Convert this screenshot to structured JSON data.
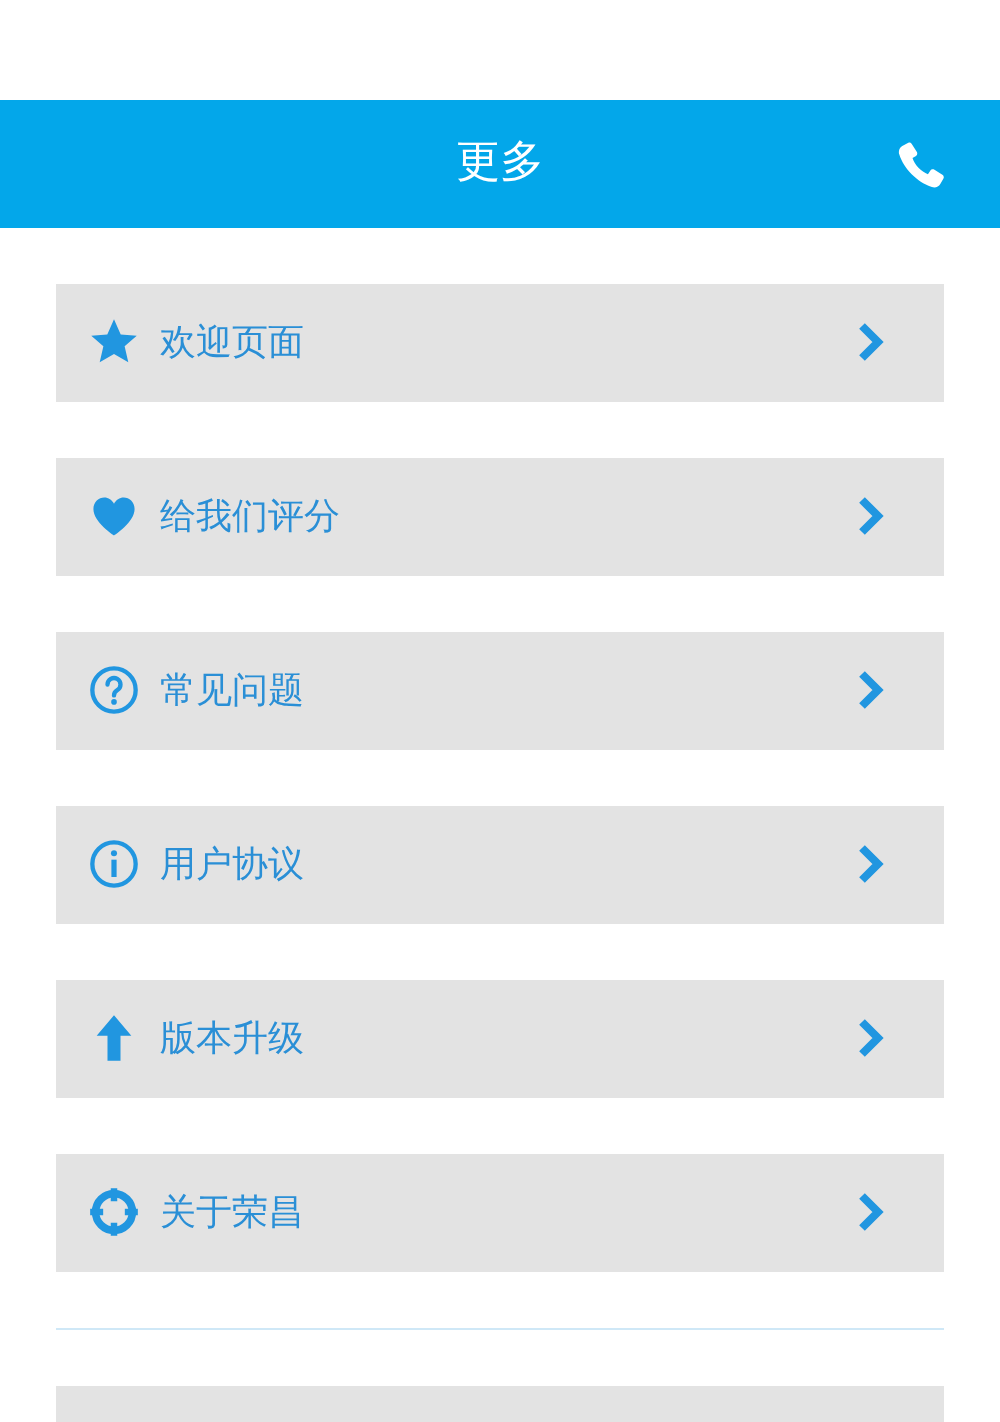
{
  "header": {
    "title": "更多"
  },
  "items": [
    {
      "label": "欢迎页面"
    },
    {
      "label": "给我们评分"
    },
    {
      "label": "常见问题"
    },
    {
      "label": "用户协议"
    },
    {
      "label": "版本升级"
    },
    {
      "label": "关于荣昌"
    }
  ]
}
